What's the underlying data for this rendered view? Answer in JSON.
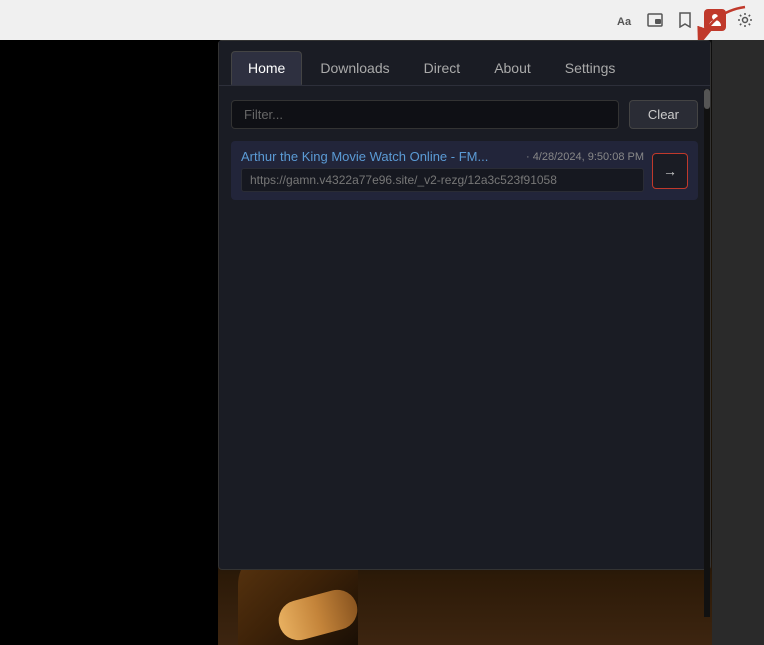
{
  "browser": {
    "toolbar_icons": [
      {
        "name": "reader-icon",
        "symbol": "Aa"
      },
      {
        "name": "pip-icon",
        "symbol": "⊡"
      },
      {
        "name": "bookmark-icon",
        "symbol": "☆"
      },
      {
        "name": "extension-icon",
        "symbol": "👤"
      },
      {
        "name": "settings-icon",
        "symbol": "⚙"
      }
    ]
  },
  "popup": {
    "tabs": [
      {
        "id": "home",
        "label": "Home",
        "active": true
      },
      {
        "id": "downloads",
        "label": "Downloads",
        "active": false
      },
      {
        "id": "direct",
        "label": "Direct",
        "active": false
      },
      {
        "id": "about",
        "label": "About",
        "active": false
      },
      {
        "id": "settings",
        "label": "Settings",
        "active": false
      }
    ],
    "filter": {
      "placeholder": "Filter...",
      "value": ""
    },
    "clear_btn_label": "Clear",
    "history_items": [
      {
        "title": "Arthur the King Movie Watch Online - FM...",
        "timestamp": "· 4/28/2024, 9:50:08 PM",
        "url": "https://gamn.v4322a77e96.site/_v2-rezg/12a3c523f91058",
        "go_btn_label": "→"
      }
    ]
  }
}
